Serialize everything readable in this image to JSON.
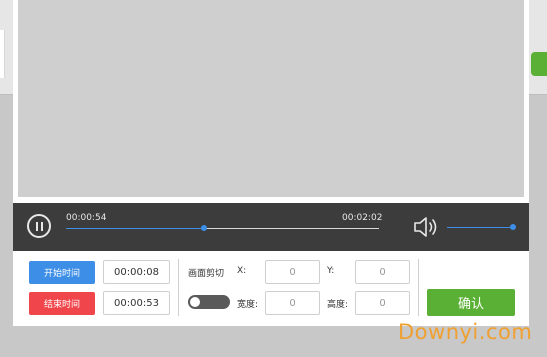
{
  "player": {
    "current_time": "00:00:54",
    "total_time": "00:02:02",
    "progress": 0.44,
    "volume": 1.0
  },
  "controls": {
    "start_button": "开始时间",
    "end_button": "结束时间",
    "start_value": "00:00:08",
    "end_value": "00:00:53",
    "crop_label": "画面剪切",
    "x_label": "X:",
    "y_label": "Y:",
    "width_label": "宽度:",
    "height_label": "高度:",
    "x_value": "0",
    "y_value": "0",
    "width_value": "0",
    "height_value": "0",
    "crop_enabled": false,
    "confirm_button": "确认"
  },
  "watermark": {
    "text": "Downyi.com"
  },
  "colors": {
    "accent_blue": "#3c8ee6",
    "danger_red": "#f0454a",
    "confirm_green": "#5ab034",
    "player_bar": "#3c3c3c"
  },
  "icons": {
    "play": "pause-icon",
    "volume": "volume-icon"
  }
}
